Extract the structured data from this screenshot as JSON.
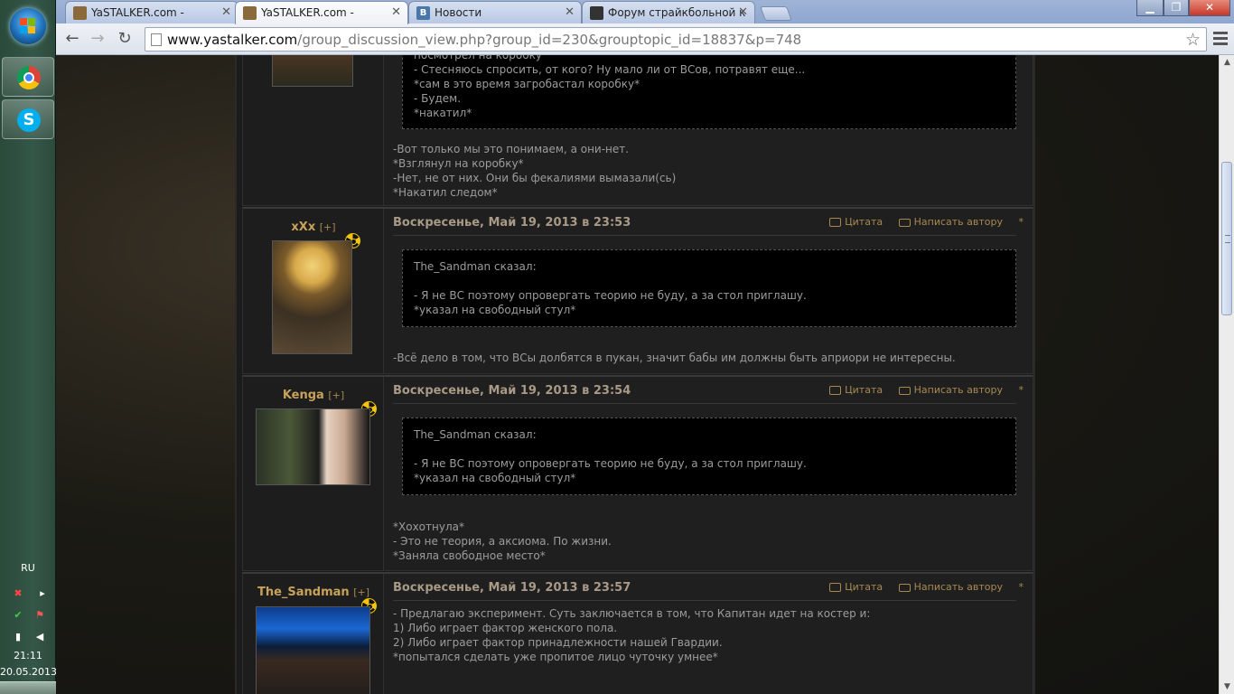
{
  "taskbar": {
    "lang": "RU",
    "time": "21:11",
    "date": "20.05.2013"
  },
  "tabs": [
    {
      "title": "YaSTALKER.com -",
      "icon": "yastalker-favicon"
    },
    {
      "title": "YaSTALKER.com -",
      "icon": "yastalker-favicon"
    },
    {
      "title": "Новости",
      "icon": "vk-favicon"
    },
    {
      "title": "Форум страйкбольной к",
      "icon": "forum-favicon"
    }
  ],
  "url": {
    "host": "www.yastalker.com",
    "path": "/group_discussion_view.php?group_id=230&grouptopic_id=18837&p=748"
  },
  "colors": {
    "accent": "#c8a25a",
    "text": "#9c9c9c",
    "background": "#1f1f1f"
  },
  "actions": {
    "quote": "Цитата",
    "write_author": "Написать автору",
    "star": "*"
  },
  "posts": [
    {
      "user": "",
      "plus": "",
      "date": "",
      "quote_lines": [
        "посмотрел на коробку",
        "- Стесняюсь спросить, от кого? Ну мало ли от ВСов, потравят еще...",
        "*сам в это время загробастал коробку*",
        "- Будем.",
        "*накатил*"
      ],
      "text_lines": [
        "-Вот только мы это понимаем, а они-нет.",
        "*Взглянул на коробку*",
        "-Нет, не от них. Они бы фекалиями вымазали(сь)",
        "*Накатил следом*"
      ]
    },
    {
      "user": "xXx",
      "plus": "[+]",
      "date": "Воскресенье, Май 19, 2013 в 23:53",
      "quote_lines": [
        "The_Sandman сказал:",
        "",
        "- Я не ВС поэтому опровергать теорию не буду, а за стол приглашу.",
        "*указал на свободный стул*"
      ],
      "text_lines": [
        "-Всё дело в том, что ВСы долбятся в пукан, значит бабы им должны быть априори не интересны."
      ]
    },
    {
      "user": "Kenga",
      "plus": "[+]",
      "date": "Воскресенье, Май 19, 2013 в 23:54",
      "quote_lines": [
        "The_Sandman сказал:",
        "",
        "- Я не ВС поэтому опровергать теорию не буду, а за стол приглашу.",
        "*указал на свободный стул*"
      ],
      "text_lines": [
        "*Хохотнула*",
        "- Это не теория, а аксиома. По жизни.",
        "*Заняла свободное место*"
      ]
    },
    {
      "user": "The_Sandman",
      "plus": "[+]",
      "date": "Воскресенье, Май 19, 2013 в 23:57",
      "quote_lines": [],
      "text_lines": [
        "- Предлагаю эксперимент. Суть заключается в том, что Капитан идет на костер и:",
        "1) Либо играет фактор женского пола.",
        "2) Либо играет фактор принадлежности нашей Гвардии.",
        "*попытался сделать уже пропитое лицо чуточку умнее*"
      ]
    }
  ]
}
